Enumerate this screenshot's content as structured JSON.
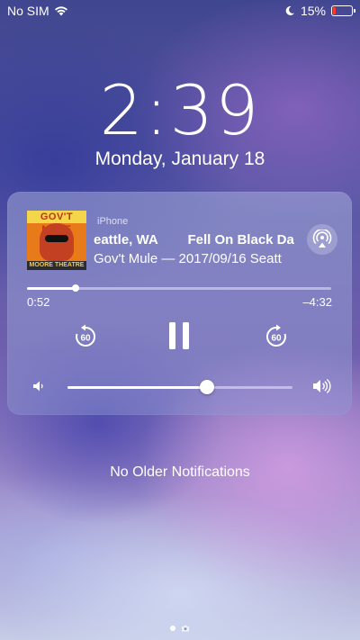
{
  "status_bar": {
    "carrier": "No SIM",
    "battery_percent": "15%",
    "battery_level": 0.15,
    "icons": [
      "wifi-icon",
      "moon-icon",
      "battery-icon"
    ],
    "battery_color": "#ff3b30"
  },
  "lock_screen": {
    "time": "2:39",
    "date": "Monday, January 18"
  },
  "now_playing": {
    "source": "iPhone",
    "album_art": {
      "top_text": "GOV'T MULE",
      "bottom_text": "MOORE THEATRE"
    },
    "title_scroll": "eattle, WA        Fell On Black Da",
    "subtitle_scroll": "Gov't Mule — 2017/09/16 Seatt",
    "elapsed": "0:52",
    "remaining": "–4:32",
    "progress": 0.16,
    "skip_back_seconds": "60",
    "skip_forward_seconds": "60",
    "volume": 0.62,
    "icons": [
      "airplay-icon",
      "skip-back-60-icon",
      "pause-icon",
      "skip-forward-60-icon",
      "volume-low-icon",
      "volume-high-icon"
    ]
  },
  "notifications": {
    "empty_text": "No Older Notifications"
  },
  "page_indicator": {
    "pages": 2,
    "active": 0,
    "icons": [
      "camera-icon"
    ]
  }
}
